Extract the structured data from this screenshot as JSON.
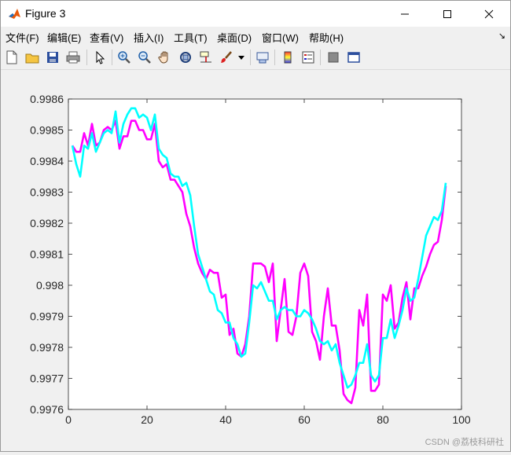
{
  "window": {
    "title": "Figure 3"
  },
  "menu": [
    {
      "label": "文件(F)"
    },
    {
      "label": "编辑(E)"
    },
    {
      "label": "查看(V)"
    },
    {
      "label": "插入(I)"
    },
    {
      "label": "工具(T)"
    },
    {
      "label": "桌面(D)"
    },
    {
      "label": "窗口(W)"
    },
    {
      "label": "帮助(H)"
    }
  ],
  "toolbar": {
    "icons": [
      "new-figure-icon",
      "open-icon",
      "save-icon",
      "print-icon",
      "select-arrow-icon",
      "zoom-in-icon",
      "zoom-out-icon",
      "pan-hand-icon",
      "rotate-3d-icon",
      "data-cursor-icon",
      "brush-icon",
      "brush-dropdown-icon",
      "link-plot-icon",
      "colorbar-icon",
      "legend-icon",
      "hide-plot-tools-icon",
      "show-plot-tools-icon"
    ]
  },
  "watermark": "CSDN @荔枝科研社",
  "chart_data": {
    "type": "line",
    "title": "",
    "xlabel": "",
    "ylabel": "",
    "xlim": [
      0,
      100
    ],
    "ylim": [
      0.9976,
      0.9986
    ],
    "xticks": [
      0,
      20,
      40,
      60,
      80,
      100
    ],
    "xtick_labels": [
      "0",
      "20",
      "40",
      "60",
      "80",
      "100"
    ],
    "yticks": [
      0.9976,
      0.9977,
      0.9978,
      0.9979,
      0.998,
      0.9981,
      0.9982,
      0.9983,
      0.9984,
      0.9985,
      0.9986
    ],
    "ytick_labels": [
      "0.9976",
      "0.9977",
      "0.9978",
      "0.9979",
      "0.998",
      "0.9981",
      "0.9982",
      "0.9983",
      "0.9984",
      "0.9985",
      "0.9986"
    ],
    "grid": false,
    "legend": null,
    "series": [
      {
        "color": "#ff00ff",
        "x": [
          1,
          2,
          3,
          4,
          5,
          6,
          7,
          8,
          9,
          10,
          11,
          12,
          13,
          14,
          15,
          16,
          17,
          18,
          19,
          20,
          21,
          22,
          23,
          24,
          25,
          26,
          27,
          28,
          29,
          30,
          31,
          32,
          33,
          34,
          35,
          36,
          37,
          38,
          39,
          40,
          41,
          42,
          43,
          44,
          45,
          46,
          47,
          48,
          49,
          50,
          51,
          52,
          53,
          54,
          55,
          56,
          57,
          58,
          59,
          60,
          61,
          62,
          63,
          64,
          65,
          66,
          67,
          68,
          69,
          70,
          71,
          72,
          73,
          74,
          75,
          76,
          77,
          78,
          79,
          80,
          81,
          82,
          83,
          84,
          85,
          86,
          87,
          88,
          89,
          90,
          91,
          92,
          93,
          94,
          95,
          96
        ],
        "y": [
          0.99845,
          0.99843,
          0.99843,
          0.99849,
          0.99845,
          0.99852,
          0.99845,
          0.99846,
          0.9985,
          0.99851,
          0.9985,
          0.99853,
          0.99844,
          0.99848,
          0.99848,
          0.99853,
          0.99853,
          0.9985,
          0.9985,
          0.99847,
          0.99847,
          0.99852,
          0.9984,
          0.99838,
          0.99839,
          0.99834,
          0.99834,
          0.99832,
          0.9983,
          0.99823,
          0.99819,
          0.99812,
          0.99807,
          0.99804,
          0.99802,
          0.99805,
          0.99804,
          0.99804,
          0.99796,
          0.99797,
          0.99784,
          0.99786,
          0.99778,
          0.99777,
          0.99781,
          0.9979,
          0.99807,
          0.99807,
          0.99807,
          0.99806,
          0.99801,
          0.99807,
          0.99782,
          0.99792,
          0.99802,
          0.99785,
          0.99784,
          0.9979,
          0.99804,
          0.99807,
          0.99803,
          0.99785,
          0.99782,
          0.99776,
          0.9979,
          0.99799,
          0.99787,
          0.99787,
          0.99779,
          0.99765,
          0.99763,
          0.99762,
          0.99767,
          0.99792,
          0.99787,
          0.99797,
          0.99766,
          0.99766,
          0.99768,
          0.99797,
          0.99795,
          0.998,
          0.99786,
          0.99788,
          0.99796,
          0.99801,
          0.99789,
          0.99799,
          0.99799,
          0.99803,
          0.99806,
          0.9981,
          0.99813,
          0.99814,
          0.99821,
          0.99832
        ]
      },
      {
        "color": "#00ffff",
        "x": [
          1,
          2,
          3,
          4,
          5,
          6,
          7,
          8,
          9,
          10,
          11,
          12,
          13,
          14,
          15,
          16,
          17,
          18,
          19,
          20,
          21,
          22,
          23,
          24,
          25,
          26,
          27,
          28,
          29,
          30,
          31,
          32,
          33,
          34,
          35,
          36,
          37,
          38,
          39,
          40,
          41,
          42,
          43,
          44,
          45,
          46,
          47,
          48,
          49,
          50,
          51,
          52,
          53,
          54,
          55,
          56,
          57,
          58,
          59,
          60,
          61,
          62,
          63,
          64,
          65,
          66,
          67,
          68,
          69,
          70,
          71,
          72,
          73,
          74,
          75,
          76,
          77,
          78,
          79,
          80,
          81,
          82,
          83,
          84,
          85,
          86,
          87,
          88,
          89,
          90,
          91,
          92,
          93,
          94,
          95,
          96
        ],
        "y": [
          0.99845,
          0.99839,
          0.99835,
          0.99845,
          0.99844,
          0.99849,
          0.99843,
          0.99846,
          0.99849,
          0.9985,
          0.99849,
          0.99856,
          0.99846,
          0.99852,
          0.99855,
          0.99857,
          0.99857,
          0.99854,
          0.99855,
          0.99854,
          0.9985,
          0.99855,
          0.99844,
          0.99842,
          0.99841,
          0.99836,
          0.99835,
          0.99835,
          0.99832,
          0.99833,
          0.99829,
          0.99819,
          0.9981,
          0.99806,
          0.99802,
          0.99798,
          0.99797,
          0.99792,
          0.99791,
          0.99788,
          0.99788,
          0.99783,
          0.99781,
          0.99777,
          0.99778,
          0.99788,
          0.998,
          0.99799,
          0.99801,
          0.99798,
          0.99795,
          0.99795,
          0.99789,
          0.99792,
          0.99793,
          0.99792,
          0.99792,
          0.9979,
          0.9979,
          0.99792,
          0.99791,
          0.99789,
          0.99786,
          0.99782,
          0.99781,
          0.99782,
          0.99779,
          0.99781,
          0.99775,
          0.99771,
          0.99767,
          0.99768,
          0.99771,
          0.99775,
          0.99775,
          0.99781,
          0.99771,
          0.99769,
          0.99771,
          0.99783,
          0.99783,
          0.99789,
          0.99783,
          0.99787,
          0.99792,
          0.99799,
          0.99795,
          0.99796,
          0.99802,
          0.99809,
          0.99816,
          0.99819,
          0.99822,
          0.99821,
          0.99824,
          0.99833
        ]
      }
    ]
  }
}
